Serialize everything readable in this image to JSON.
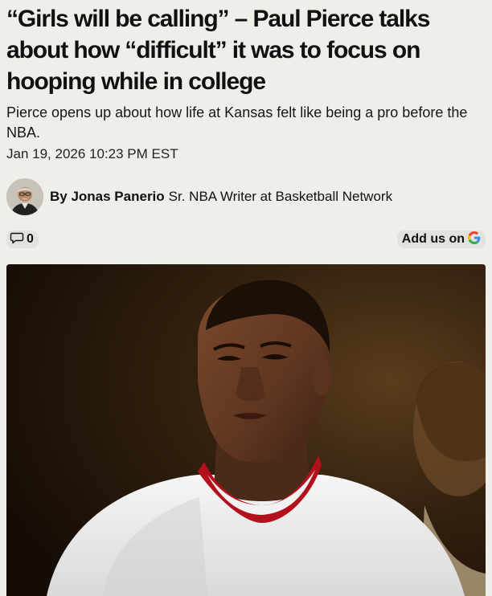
{
  "article": {
    "headline": "“Girls will be calling” – Paul Pierce talks about how “difficult” it was to focus on hooping while in college",
    "subhead": "Pierce opens up about how life at Kansas felt like being a pro before the NBA.",
    "date": "Jan 19, 2026 10:23 PM EST"
  },
  "byline": {
    "author": "By Jonas Panerio",
    "role": "Sr. NBA Writer at Basketball Network"
  },
  "actions": {
    "comment_count": "0",
    "google_label": "Add us on"
  },
  "icons": {
    "comment": "comment-icon",
    "google": "google-g-icon"
  },
  "colors": {
    "background": "#efefea",
    "google_blue": "#4285F4",
    "google_red": "#EA4335",
    "google_yellow": "#FBBC05",
    "google_green": "#34A853"
  }
}
